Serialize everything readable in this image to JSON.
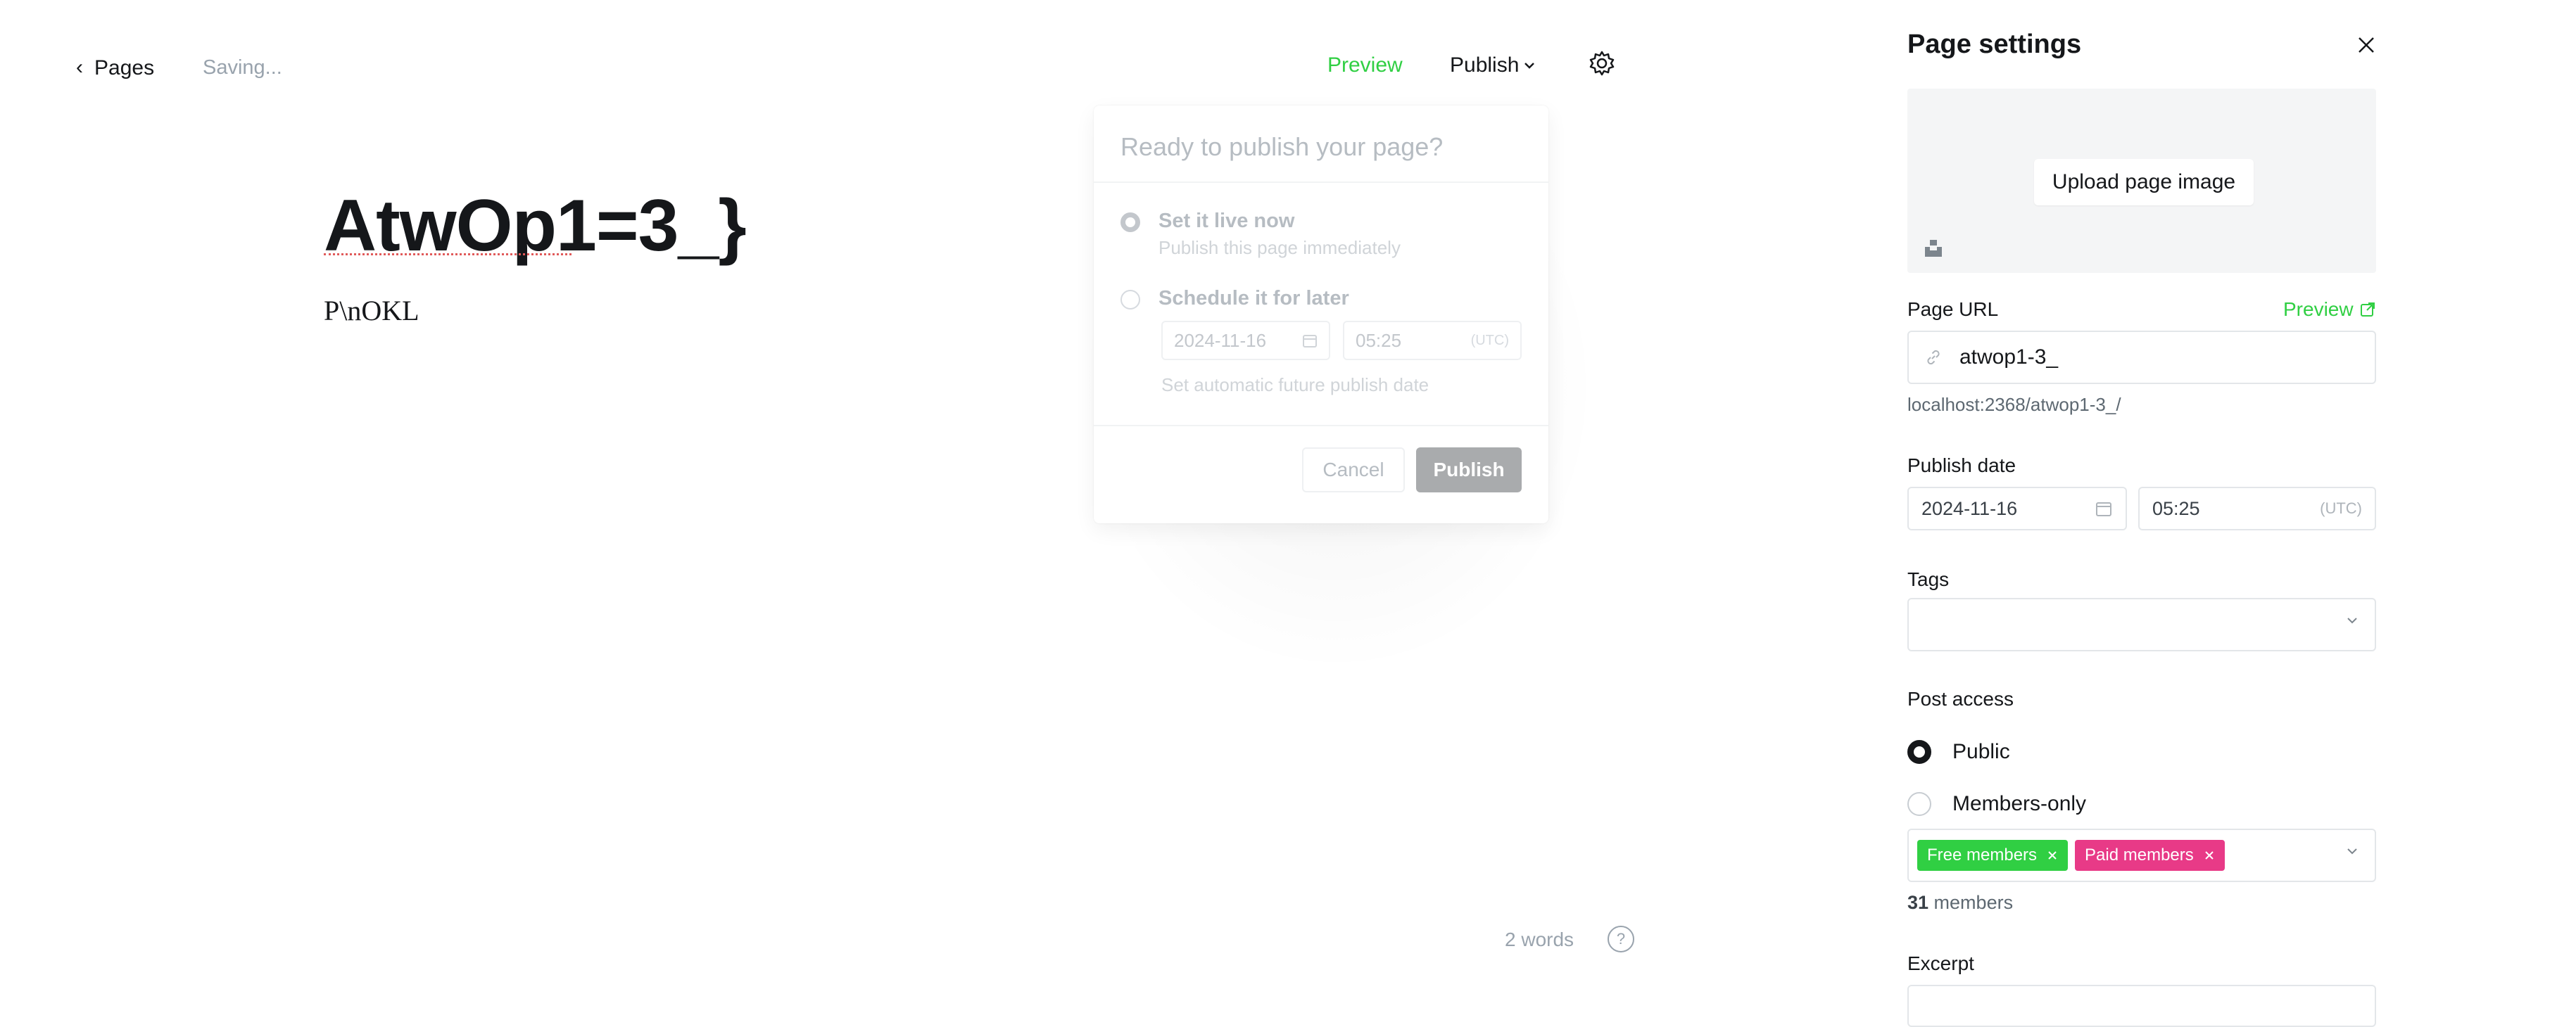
{
  "topbar": {
    "back_label": "Pages",
    "status": "Saving...",
    "preview_label": "Preview",
    "publish_label": "Publish"
  },
  "editor": {
    "title": "AtwOp1=3_}",
    "body": "P\\nOKL",
    "word_count": "2 words",
    "help_glyph": "?"
  },
  "publish_popover": {
    "heading": "Ready to publish your page?",
    "option_now_label": "Set it live now",
    "option_now_sub": "Publish this page immediately",
    "option_later_label": "Schedule it for later",
    "date": "2024-11-16",
    "time": "05:25",
    "timezone": "(UTC)",
    "later_hint": "Set automatic future publish date",
    "cancel_label": "Cancel",
    "publish_label": "Publish",
    "selected_option": "now"
  },
  "settings": {
    "title": "Page settings",
    "upload_label": "Upload page image",
    "url_label": "Page URL",
    "url_preview_label": "Preview",
    "url_value": "atwop1-3_",
    "url_hint": "localhost:2368/atwop1-3_/",
    "publish_date_label": "Publish date",
    "publish_date": "2024-11-16",
    "publish_time": "05:25",
    "timezone": "(UTC)",
    "tags_label": "Tags",
    "access_label": "Post access",
    "access_public": "Public",
    "access_members": "Members-only",
    "selected_access": "Public",
    "chip_free": "Free members",
    "chip_paid": "Paid members",
    "members_count": "31",
    "members_suffix": " members",
    "excerpt_label": "Excerpt"
  },
  "colors": {
    "accent_green": "#30cf43",
    "paid_pink": "#e83a87",
    "text_dark": "#15171a",
    "muted": "#99a3ad"
  }
}
